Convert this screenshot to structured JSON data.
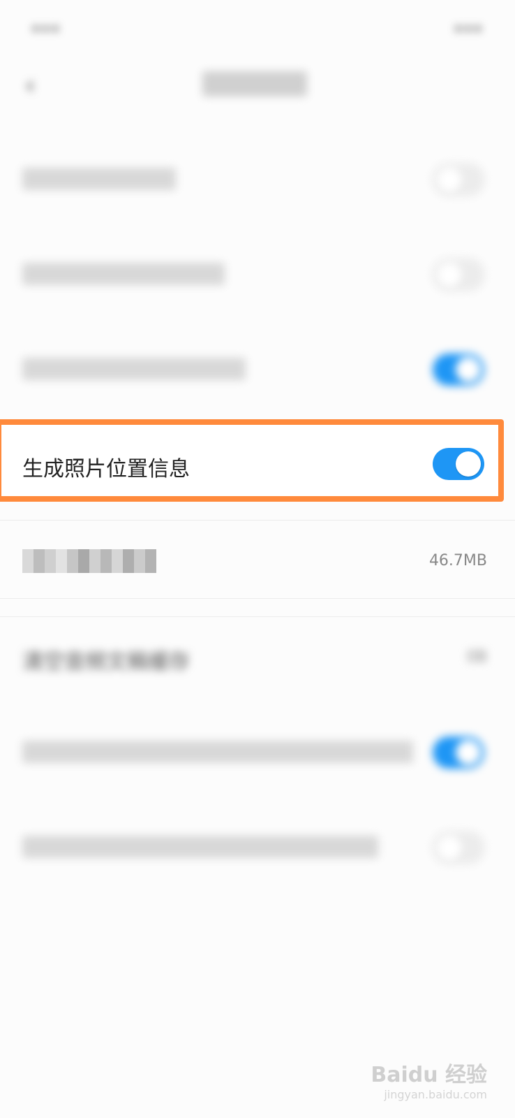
{
  "status_bar": {
    "left": "•••",
    "right": "•••"
  },
  "nav": {
    "back": "‹",
    "title": ""
  },
  "settings": {
    "row1_label": "",
    "row2_label": "",
    "row3_label": "",
    "highlight_label": "生成照片位置信息",
    "storage_value": "46.7MB",
    "clear_audio_label": "清空音频文稿缓存",
    "clear_audio_value": "0B",
    "row8_label": "",
    "row9_label": ""
  },
  "toggles": {
    "row1": "off",
    "row2": "off",
    "row3": "on",
    "highlight": "on",
    "row8": "on",
    "row9": "off"
  },
  "colors": {
    "accent": "#1e96f5",
    "highlight_border": "#ff8a3c"
  },
  "watermark": {
    "brand": "Baidu 经验",
    "url": "jingyan.baidu.com"
  }
}
